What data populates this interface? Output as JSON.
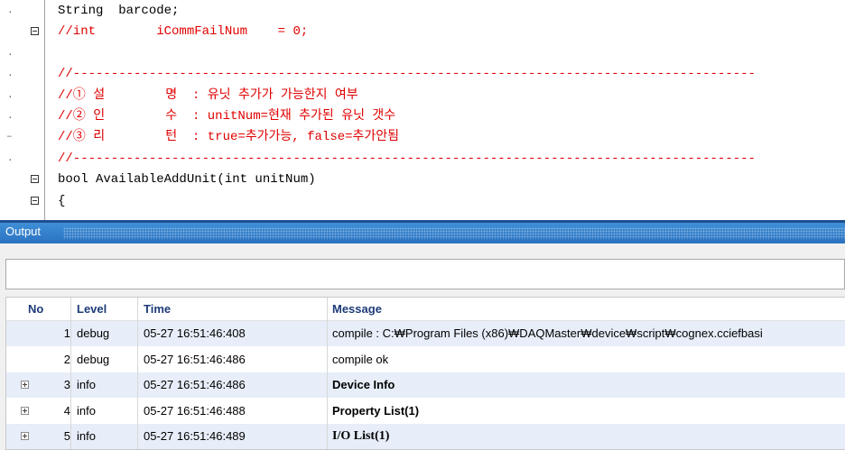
{
  "editor": {
    "lines": [
      {
        "mark": ".",
        "fold": false,
        "parts": [
          {
            "t": "String  barcode;",
            "c": "kw"
          }
        ]
      },
      {
        "mark": "",
        "fold": true,
        "parts": [
          {
            "t": "//int        iCommFailNum    = 0;",
            "c": "red"
          }
        ]
      },
      {
        "mark": ".",
        "fold": false,
        "parts": []
      },
      {
        "mark": ".",
        "fold": false,
        "parts": [
          {
            "t": "//------------------------------------------------------------------------------------------",
            "c": "red"
          }
        ]
      },
      {
        "mark": ".",
        "fold": false,
        "parts": [
          {
            "t": "//① 설        명  : 유닛 추가가 가능한지 여부",
            "c": "red"
          }
        ]
      },
      {
        "mark": ".",
        "fold": false,
        "parts": [
          {
            "t": "//② 인        수  : unitNum=현재 추가된 유닛 갯수",
            "c": "red"
          }
        ]
      },
      {
        "mark": "–",
        "fold": false,
        "parts": [
          {
            "t": "//③ 리        턴  : true=추가가능, false=추가안됨",
            "c": "red"
          }
        ]
      },
      {
        "mark": ".",
        "fold": false,
        "parts": [
          {
            "t": "//------------------------------------------------------------------------------------------",
            "c": "red"
          }
        ]
      },
      {
        "mark": "",
        "fold": true,
        "parts": [
          {
            "t": "bool AvailableAddUnit(int unitNum)",
            "c": "kw"
          }
        ]
      },
      {
        "mark": "",
        "fold": true,
        "parts": [
          {
            "t": "{",
            "c": "kw"
          }
        ]
      }
    ]
  },
  "output": {
    "title": "Output",
    "filter_value": "",
    "columns": {
      "no": "No",
      "level": "Level",
      "time": "Time",
      "message": "Message"
    },
    "rows": [
      {
        "no": "1",
        "expandable": false,
        "level": "debug",
        "time": "05-27 16:51:46:408",
        "message": "compile : C:₩Program Files (x86)₩DAQMaster₩device₩script₩cognex.cciefbasi",
        "bold": false
      },
      {
        "no": "2",
        "expandable": false,
        "level": "debug",
        "time": "05-27 16:51:46:486",
        "message": "compile ok",
        "bold": false
      },
      {
        "no": "3",
        "expandable": true,
        "level": "info",
        "time": "05-27 16:51:46:486",
        "message": "Device Info",
        "bold": true
      },
      {
        "no": "4",
        "expandable": true,
        "level": "info",
        "time": "05-27 16:51:46:488",
        "message": "Property List(1)",
        "bold": true
      },
      {
        "no": "5",
        "expandable": true,
        "level": "info",
        "time": "05-27 16:51:46:489",
        "message": "I/O List(1)",
        "bold": true
      }
    ]
  }
}
